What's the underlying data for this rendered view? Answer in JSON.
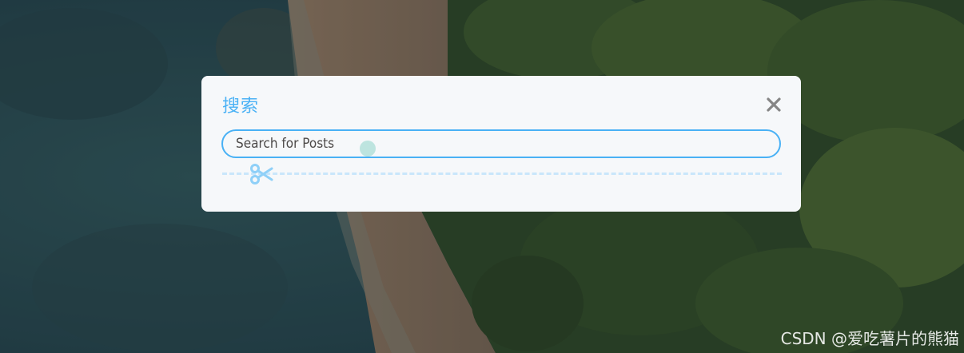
{
  "modal": {
    "title": "搜索",
    "search_placeholder": "Search for Posts",
    "search_value": ""
  },
  "icons": {
    "close": "close-icon",
    "divider": "scissors-icon"
  },
  "colors": {
    "accent": "#49b1f5",
    "modal_bg": "#f6f8fa",
    "divider": "#c9e6fb",
    "text": "#4c4948",
    "close_icon": "#858585"
  },
  "watermark": "CSDN @爱吃薯片的熊猫"
}
